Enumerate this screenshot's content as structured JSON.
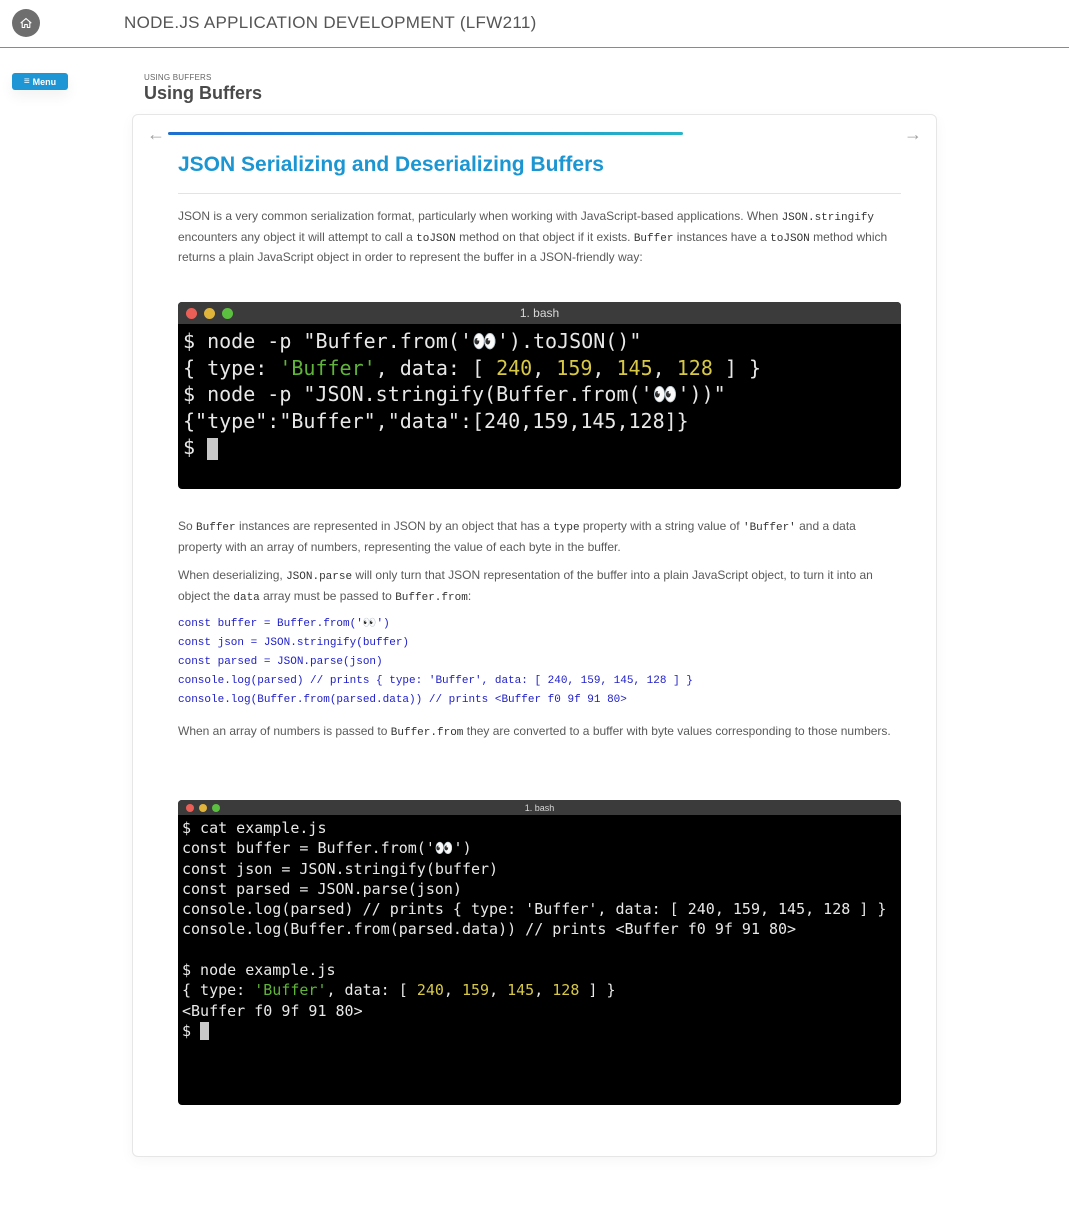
{
  "header": {
    "course_title": "NODE.JS APPLICATION DEVELOPMENT (LFW211)"
  },
  "menu": {
    "label": "Menu"
  },
  "breadcrumb": "USING BUFFERS",
  "section_title": "Using Buffers",
  "progress_fraction": 0.705,
  "page": {
    "heading": "JSON Serializing and Deserializing Buffers",
    "intro": {
      "t1": "JSON is a very common serialization format, particularly when working with JavaScript-based applications. When ",
      "c1": "JSON.stringify",
      "t2": " encounters any object it will attempt to call a ",
      "c2": "toJSON",
      "t3": " method on that object if it exists. ",
      "c3": "Buffer",
      "t4": " instances have a ",
      "c4": "toJSON",
      "t5": " method which returns a plain JavaScript object in order to represent the buffer in a JSON-friendly way:"
    },
    "terminal1": {
      "title": "1. bash",
      "l1": "$ node -p \"Buffer.from('👀').toJSON()\"",
      "l2_a": "{ type: ",
      "l2_str": "'Buffer'",
      "l2_b": ", data: [ ",
      "n1": "240",
      "n2": "159",
      "n3": "145",
      "n4": "128",
      "l2_c": " ] }",
      "l3": "$ node -p \"JSON.stringify(Buffer.from('👀'))\"",
      "l4": "{\"type\":\"Buffer\",\"data\":[240,159,145,128]}",
      "prompt": "$ "
    },
    "para2": {
      "t1": "So ",
      "c1": "Buffer",
      "t2": " instances are represented in JSON by an object that has a ",
      "c2": "type",
      "t3": " property with a string value of ",
      "c3": "'Buffer'",
      "t4": " and a data property with an array of numbers, representing the value of each byte in the buffer."
    },
    "para3": {
      "t1": "When deserializing, ",
      "c1": "JSON.parse",
      "t2": " will only turn that JSON representation of the buffer into a plain JavaScript object, to turn it into an object the ",
      "c2": "data",
      "t3": " array must be passed to ",
      "c3": "Buffer.from",
      "t4": ":"
    },
    "code_lines": [
      "const buffer = Buffer.from('👀')",
      "const json = JSON.stringify(buffer)",
      "const parsed = JSON.parse(json)",
      "console.log(parsed) // prints { type: 'Buffer', data: [ 240, 159, 145, 128 ] }",
      "console.log(Buffer.from(parsed.data)) // prints <Buffer f0 9f 91 80>"
    ],
    "para4": {
      "t1": "When an array of numbers is passed to ",
      "c1": "Buffer.from",
      "t2": " they are converted to a buffer with byte values corresponding to those numbers."
    },
    "terminal2": {
      "title": "1. bash",
      "lines": [
        "$ cat example.js",
        "const buffer = Buffer.from('👀')",
        "const json = JSON.stringify(buffer)",
        "const parsed = JSON.parse(json)",
        "console.log(parsed) // prints { type: 'Buffer', data: [ 240, 159, 145, 128 ] }",
        "console.log(Buffer.from(parsed.data)) // prints <Buffer f0 9f 91 80>",
        "",
        "$ node example.js"
      ],
      "out_a": "{ type: ",
      "out_str": "'Buffer'",
      "out_b": ", data: [ ",
      "n1": "240",
      "n2": "159",
      "n3": "145",
      "n4": "128",
      "out_c": " ] }",
      "out2": "<Buffer f0 9f 91 80>",
      "prompt": "$ "
    }
  },
  "colors": {
    "accent": "#1b96d2",
    "menu_button": "#1e95d4",
    "terminal_green": "#5fb43a",
    "terminal_yellow": "#d7c846",
    "code_blue": "#2020c8"
  },
  "icons": {
    "home": "home-icon",
    "menu": "hamburger-icon",
    "prev": "arrow-left-icon",
    "next": "arrow-right-icon"
  }
}
